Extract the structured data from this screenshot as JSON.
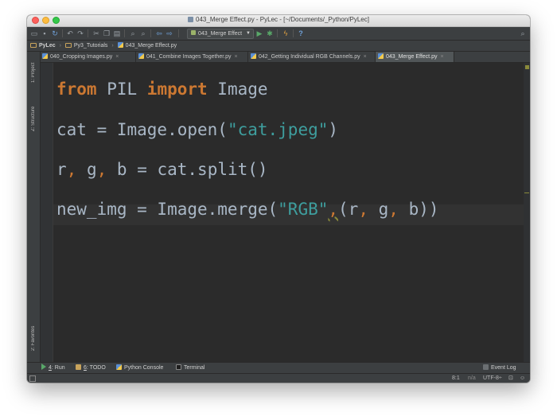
{
  "window": {
    "title": "043_Merge Effect.py - PyLec - [~/Documents/_Python/PyLec]"
  },
  "toolbar": {
    "run_config": "043_Merge Effect",
    "icons": [
      "open-folder-icon",
      "save-icon",
      "sync-icon",
      "undo-icon",
      "redo-icon",
      "cut-icon",
      "copy-icon",
      "paste-icon",
      "find-icon",
      "replace-icon",
      "back-icon",
      "forward-icon",
      "run-icon",
      "debug-icon",
      "vcs-icon",
      "help-icon",
      "search-icon"
    ]
  },
  "navbar": {
    "crumbs": [
      "PyLec",
      "Py3_Tutorials",
      "043_Merge Effect.py"
    ]
  },
  "tabs": [
    {
      "label": "040_Cropping Images.py",
      "active": false
    },
    {
      "label": "041_Combine Images Together.py",
      "active": false
    },
    {
      "label": "042_Getting Individual RGB Channels.py",
      "active": false
    },
    {
      "label": "043_Merge Effect.py",
      "active": true
    }
  ],
  "side_tools": {
    "project": "1: Project",
    "structure": "Z: Structure",
    "favorites": "2: Favorites"
  },
  "code": {
    "line1": {
      "kw1": "from",
      "mod": " PIL ",
      "kw2": "import",
      "name": " Image"
    },
    "line2": {
      "pre": "cat = Image.open(",
      "str": "\"cat.jpeg\"",
      "post": ")"
    },
    "line3": {
      "a": "r",
      "c1": ",",
      "b": " g",
      "c2": ",",
      "c": " b = cat.split()"
    },
    "line4": {
      "pre": "new_img = Image.merge(",
      "str": "\"RGB\"",
      "c0": ",",
      "p1": "(r",
      "c1": ",",
      "p2": " g",
      "c2": ",",
      "p3": " b))"
    }
  },
  "tool_windows": {
    "run": {
      "num": "4",
      "label": ": Run"
    },
    "todo": {
      "num": "6",
      "label": ": TODO"
    },
    "console": "Python Console",
    "terminal": "Terminal",
    "event_log": "Event Log"
  },
  "status": {
    "position": "8:1",
    "na": "n/a",
    "encoding": "UTF-8÷"
  },
  "colors": {
    "keyword": "#cc7832",
    "string": "#3e9e9e",
    "text": "#a9b7c6",
    "background": "#2b2b2b"
  }
}
